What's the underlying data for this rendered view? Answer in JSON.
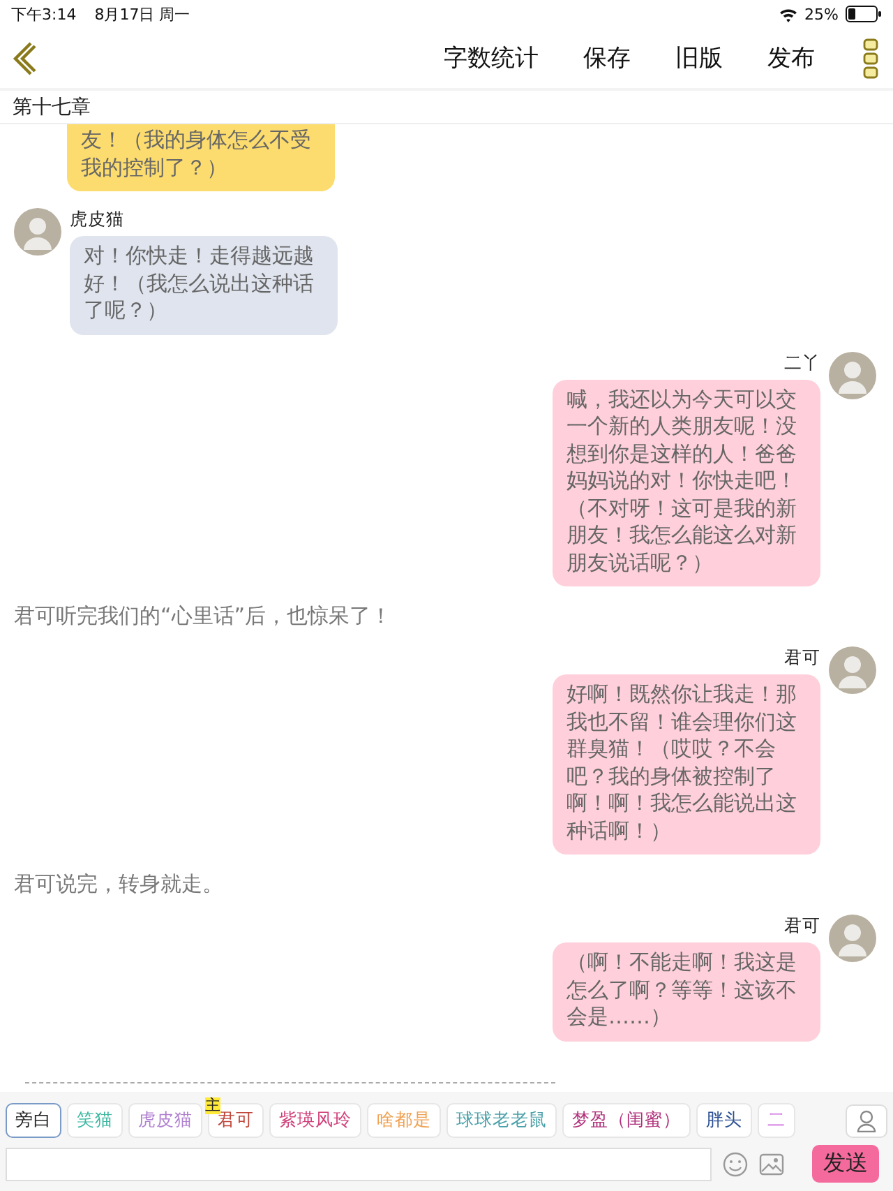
{
  "status_bar": {
    "time": "下午3:14",
    "date": "8月17日 周一",
    "battery": "25%"
  },
  "nav": {
    "actions": [
      "字数统计",
      "保存",
      "旧版",
      "发布"
    ]
  },
  "chapter_title": "第十七章",
  "messages": [
    {
      "kind": "received",
      "color": "#fcdc6e",
      "text": "友！（我的身体怎么不受我的控制了？）"
    },
    {
      "kind": "received",
      "color": "#dfe4ee",
      "name": "虎皮猫",
      "text": "对！你快走！走得越远越好！（我怎么说出这种话了呢？）"
    },
    {
      "kind": "sent",
      "color": "#ffd0db",
      "name": "二丫",
      "text": "喊，我还以为今天可以交一个新的人类朋友呢！没想到你是这样的人！爸爸妈妈说的对！你快走吧！（不对呀！这可是我的新朋友！我怎么能这么对新朋友说话呢？）"
    },
    {
      "kind": "narration",
      "text": "君可听完我们的“心里话”后，也惊呆了！"
    },
    {
      "kind": "sent",
      "color": "#ffd0db",
      "name": "君可",
      "text": "好啊！既然你让我走！那我也不留！谁会理你们这群臭猫！（哎哎？不会吧？我的身体被控制了啊！啊！我怎么能说出这种话啊！）"
    },
    {
      "kind": "narration",
      "text": "君可说完，转身就走。"
    },
    {
      "kind": "sent",
      "color": "#ffd0db",
      "name": "君可",
      "text": "（啊！不能走啊！我这是怎么了啊？等等！这该不会是……）"
    }
  ],
  "characters": [
    {
      "label": "旁白",
      "color": "#222222",
      "selected": true
    },
    {
      "label": "笑猫",
      "color": "#3bb7a0",
      "selected": false
    },
    {
      "label": "虎皮猫",
      "color": "#b07fd0",
      "selected": false
    },
    {
      "label": "君可",
      "color": "#c0453a",
      "selected": false,
      "badge": "主"
    },
    {
      "label": "紫瑛风玲",
      "color": "#d0407a",
      "selected": false
    },
    {
      "label": "啥都是",
      "color": "#f0a050",
      "selected": false
    },
    {
      "label": "球球老老鼠",
      "color": "#4aa0a8",
      "selected": false
    },
    {
      "label": "梦盈（闺蜜）",
      "color": "#b0307a",
      "selected": false
    },
    {
      "label": "胖头",
      "color": "#2a4f90",
      "selected": false
    },
    {
      "label": "二",
      "color": "#d070e0",
      "selected": false
    }
  ],
  "composer": {
    "send": "发送"
  }
}
